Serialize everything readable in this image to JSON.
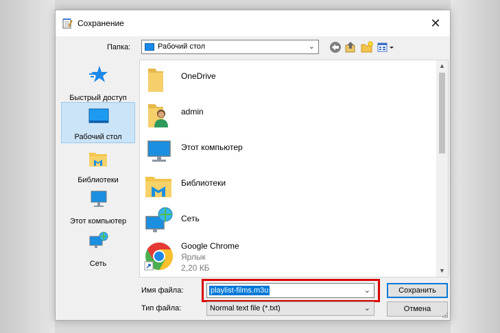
{
  "window": {
    "title": "Сохранение",
    "close_glyph": "✕"
  },
  "folder": {
    "label": "Папка:",
    "current": "Рабочий стол"
  },
  "toolbar": {
    "icons": [
      "back-arrow-icon",
      "up-folder-icon",
      "new-folder-icon",
      "view-menu-icon"
    ]
  },
  "places": [
    {
      "label": "Быстрый доступ",
      "icon": "star-icon"
    },
    {
      "label": "Рабочий стол",
      "icon": "desktop-icon",
      "selected": true
    },
    {
      "label": "Библиотеки",
      "icon": "libraries-icon"
    },
    {
      "label": "Этот компьютер",
      "icon": "computer-icon"
    },
    {
      "label": "Сеть",
      "icon": "network-icon"
    }
  ],
  "files": [
    {
      "name": "OneDrive",
      "icon": "folder-icon"
    },
    {
      "name": "admin",
      "icon": "user-folder-icon"
    },
    {
      "name": "Этот компьютер",
      "icon": "computer-icon"
    },
    {
      "name": "Библиотеки",
      "icon": "libraries-icon"
    },
    {
      "name": "Сеть",
      "icon": "network-icon"
    },
    {
      "name": "Google Chrome",
      "type": "Ярлык",
      "size": "2,20 КБ",
      "icon": "chrome-icon"
    }
  ],
  "form": {
    "filename_label": "Имя файла:",
    "filename_value": "playlist-films.m3u",
    "filetype_label": "Тип файла:",
    "filetype_value": "Normal text file (*.txt)"
  },
  "buttons": {
    "save": "Сохранить",
    "cancel": "Отмена"
  },
  "colors": {
    "selection": "#0078d7",
    "highlight_box": "#d90000"
  }
}
